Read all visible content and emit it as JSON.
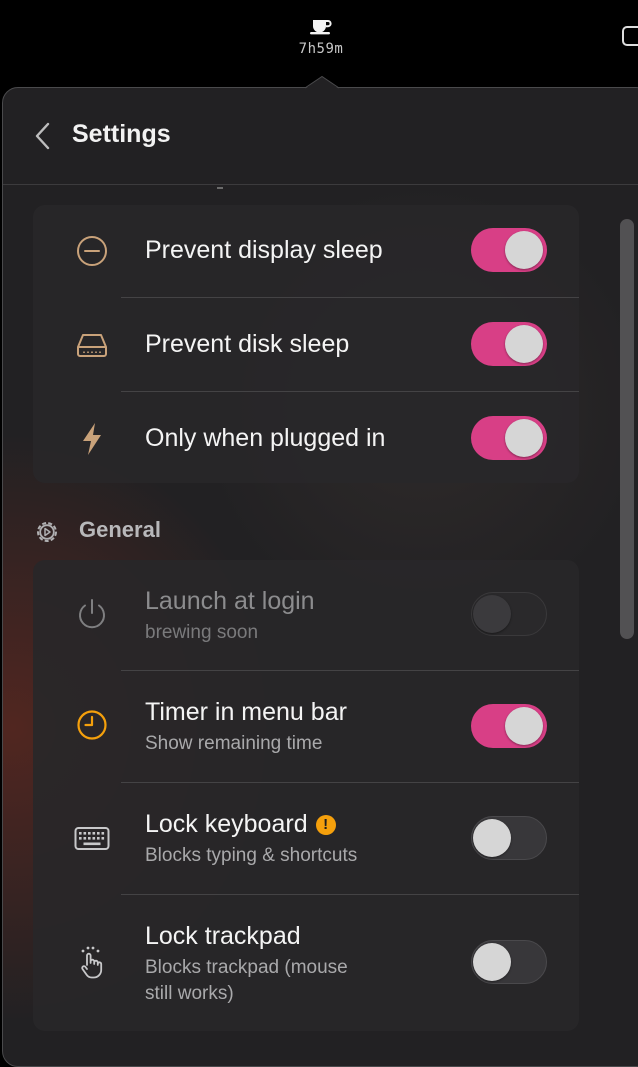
{
  "menubar": {
    "timer_text": "7h59m",
    "app_icon": "coffee-cup-icon",
    "battery_icon": "battery-icon"
  },
  "header": {
    "title": "Settings",
    "back_icon": "chevron-left-icon"
  },
  "colors": {
    "accent": "#d83f86",
    "icon_tan": "#c9a27a",
    "icon_orange": "#f5a00c",
    "warning": "#f5a00c"
  },
  "sleep_settings": [
    {
      "label": "Prevent display sleep",
      "icon": "minus-circle-icon",
      "enabled": true
    },
    {
      "label": "Prevent disk sleep",
      "icon": "disk-drive-icon",
      "enabled": true
    },
    {
      "label": "Only when plugged in",
      "icon": "lightning-bolt-icon",
      "enabled": true
    }
  ],
  "general": {
    "section_label": "General",
    "section_icon": "gear-icon",
    "items": [
      {
        "label": "Launch at login",
        "subtitle": "brewing soon",
        "icon": "power-icon",
        "enabled": false,
        "disabled": true
      },
      {
        "label": "Timer in menu bar",
        "subtitle": "Show remaining time",
        "icon": "clock-icon",
        "enabled": true
      },
      {
        "label": "Lock keyboard",
        "subtitle": "Blocks typing & shortcuts",
        "icon": "keyboard-icon",
        "enabled": false,
        "badge": "!"
      },
      {
        "label": "Lock trackpad",
        "subtitle_line1": "Blocks trackpad (mouse",
        "subtitle_line2": "still works)",
        "icon": "pointer-hand-icon",
        "enabled": false
      }
    ]
  }
}
